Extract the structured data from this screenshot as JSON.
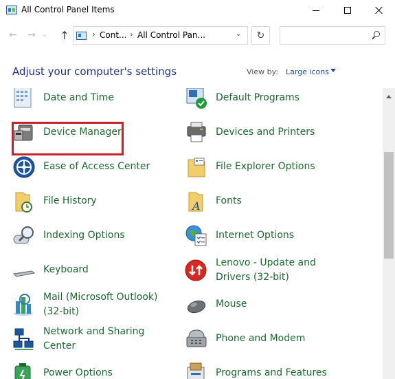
{
  "window": {
    "title": "All Control Panel Items"
  },
  "nav": {
    "back": "←",
    "forward": "→",
    "recent": "⌄",
    "up": "↑",
    "breadcrumb": [
      "Cont...",
      "All Control Pan..."
    ],
    "dropdown": "⌄",
    "refresh": "↻",
    "search_placeholder": ""
  },
  "header": {
    "heading": "Adjust your computer's settings",
    "view_by_label": "View by:",
    "view_by_value": "Large icons"
  },
  "items": [
    {
      "label": "Date and Time",
      "icon": "calendar-clock-icon"
    },
    {
      "label": "Default Programs",
      "icon": "default-programs-icon"
    },
    {
      "label": "Device Manager",
      "icon": "device-manager-icon",
      "highlighted": true
    },
    {
      "label": "Devices and Printers",
      "icon": "printer-icon"
    },
    {
      "label": "Ease of Access Center",
      "icon": "ease-of-access-icon"
    },
    {
      "label": "File Explorer Options",
      "icon": "folder-options-icon"
    },
    {
      "label": "File History",
      "icon": "file-history-icon"
    },
    {
      "label": "Fonts",
      "icon": "fonts-icon"
    },
    {
      "label": "Indexing Options",
      "icon": "indexing-icon"
    },
    {
      "label": "Internet Options",
      "icon": "internet-options-icon"
    },
    {
      "label": "Keyboard",
      "icon": "keyboard-icon"
    },
    {
      "label": "Lenovo - Update and\nDrivers (32-bit)",
      "icon": "lenovo-update-icon"
    },
    {
      "label": "Mail (Microsoft Outlook)\n(32-bit)",
      "icon": "mail-icon"
    },
    {
      "label": "Mouse",
      "icon": "mouse-icon"
    },
    {
      "label": "Network and Sharing\nCenter",
      "icon": "network-icon"
    },
    {
      "label": "Phone and Modem",
      "icon": "phone-icon"
    },
    {
      "label": "Power Options",
      "icon": "power-options-icon"
    },
    {
      "label": "Programs and Features",
      "icon": "programs-features-icon"
    }
  ],
  "colors": {
    "link": "#1a6a2c",
    "heading": "#1e3287",
    "highlight": "#c8222b"
  }
}
